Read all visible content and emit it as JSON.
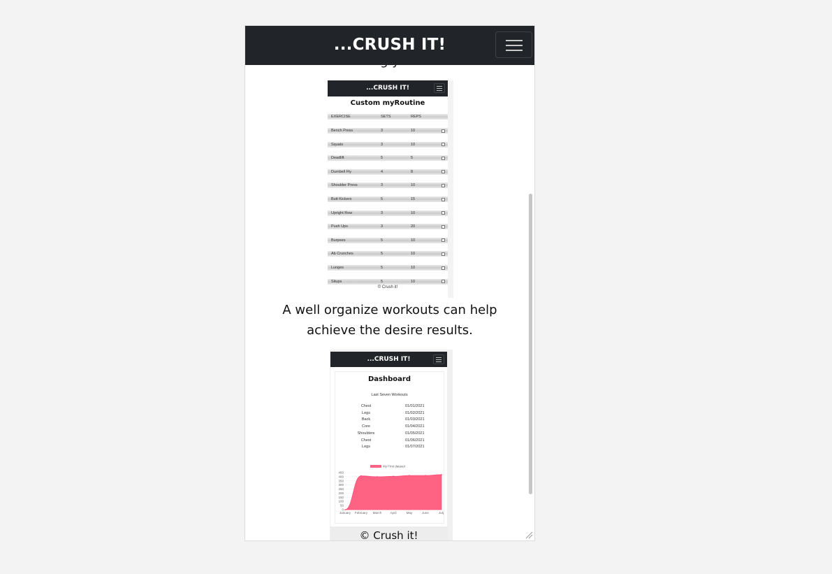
{
  "app": {
    "brand": "...CRUSH IT!",
    "cut_text": "g             y"
  },
  "routine_shot": {
    "brand": "...CRUSH IT!",
    "title": "Custom myRoutine",
    "columns": [
      "EXERCISE",
      "SETS",
      "REPS"
    ],
    "rows": [
      {
        "exercise": "Bench Press",
        "sets": "3",
        "reps": "10"
      },
      {
        "exercise": "Squats",
        "sets": "3",
        "reps": "10"
      },
      {
        "exercise": "Deadlift",
        "sets": "5",
        "reps": "5"
      },
      {
        "exercise": "Dumbell Fly",
        "sets": "4",
        "reps": "8"
      },
      {
        "exercise": "Shoulder Press",
        "sets": "3",
        "reps": "10"
      },
      {
        "exercise": "Butt Kickers",
        "sets": "5",
        "reps": "15"
      },
      {
        "exercise": "Upright Row",
        "sets": "3",
        "reps": "10"
      },
      {
        "exercise": "Push Ups",
        "sets": "3",
        "reps": "20"
      },
      {
        "exercise": "Burpees",
        "sets": "5",
        "reps": "10"
      },
      {
        "exercise": "Ab Crunches",
        "sets": "5",
        "reps": "10"
      },
      {
        "exercise": "Lunges",
        "sets": "5",
        "reps": "10"
      },
      {
        "exercise": "Situps",
        "sets": "5",
        "reps": "10"
      }
    ],
    "footer": "© Crush it!"
  },
  "paragraph": "A well organize workouts can help achieve the desire results.",
  "dashboard_shot": {
    "brand": "...CRUSH IT!",
    "title": "Dashboard",
    "subtitle": "Last Seven Workouts",
    "workouts": [
      {
        "name": "Chest",
        "date": "01/01/2021"
      },
      {
        "name": "Legs",
        "date": "01/02/2021"
      },
      {
        "name": "Back",
        "date": "01/03/2021"
      },
      {
        "name": "Core",
        "date": "01/04/2021"
      },
      {
        "name": "Shoulders",
        "date": "01/05/2021"
      },
      {
        "name": "Chest",
        "date": "01/06/2021"
      },
      {
        "name": "Legs",
        "date": "01/07/2021"
      }
    ]
  },
  "chart_data": {
    "type": "area",
    "series": [
      {
        "name": "My First dataset",
        "values": [
          0,
          410,
          400,
          405,
          415,
          415,
          425
        ],
        "color": "#ff6384"
      }
    ],
    "categories": [
      "January",
      "February",
      "March",
      "April",
      "May",
      "June",
      "July"
    ],
    "ylim": [
      0,
      450
    ],
    "yticks": [
      0,
      50,
      100,
      150,
      200,
      250,
      300,
      350,
      400,
      450
    ],
    "legend": "top",
    "grid": true
  },
  "footer": "© Crush it!"
}
